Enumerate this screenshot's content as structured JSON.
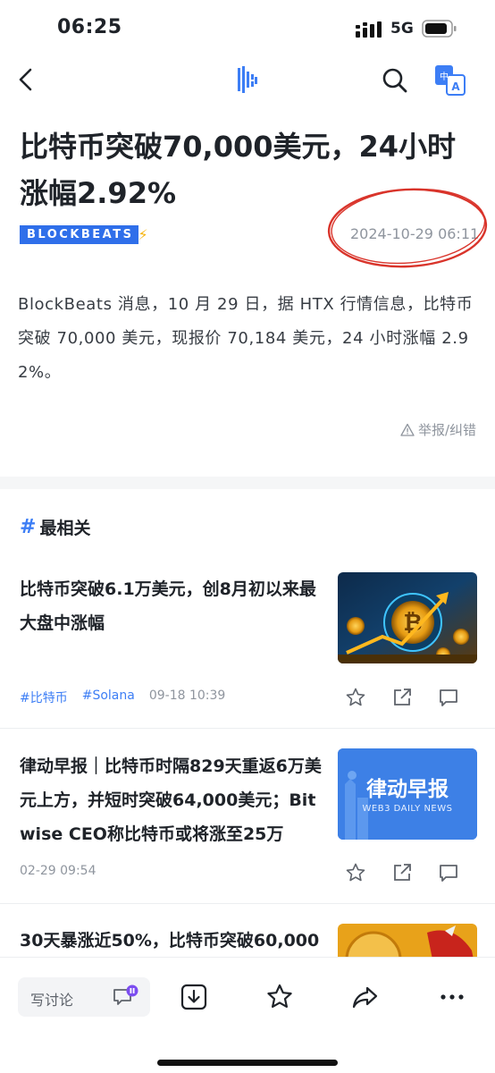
{
  "status_bar": {
    "time": "06:25",
    "network": "5G"
  },
  "nav": {
    "back_icon": "chevron-left-icon",
    "logo_icon": "blockbeats-logo-icon",
    "search_icon": "search-icon",
    "translate_icon": "translate-icon"
  },
  "article": {
    "title": "比特币突破70,000美元，24小时涨幅2.92%",
    "source_logo": "BLOCKBEATS",
    "timestamp": "2024-10-29 06:11",
    "body": "BlockBeats 消息，10 月 29 日，据 HTX 行情信息，比特币突破 70,000 美元，现报价 70,184 美元，24 小时涨幅 2.92%。",
    "report_label": "举报/纠错"
  },
  "related": {
    "heading": "最相关",
    "items": [
      {
        "title": "比特币突破6.1万美元，创8月初以来最大盘中涨幅",
        "tags": [
          "#比特币",
          "#Solana"
        ],
        "date": "09-18 10:39"
      },
      {
        "title": "律动早报｜比特币时隔829天重返6万美元上方，并短时突破64,000美元；Bitwise CEO称比特币或将涨至25万",
        "tags": [],
        "date": "02-29 09:54",
        "thumb_title": "律动早报",
        "thumb_subtitle": "WEB3 DAILY NEWS"
      },
      {
        "title": "30天暴涨近50%，比特币突破60,000"
      }
    ]
  },
  "bottom_bar": {
    "comment_placeholder": "写讨论"
  },
  "colors": {
    "accent": "#3d7ef5",
    "brand": "#2f6fea",
    "annotation": "#d9342b"
  }
}
